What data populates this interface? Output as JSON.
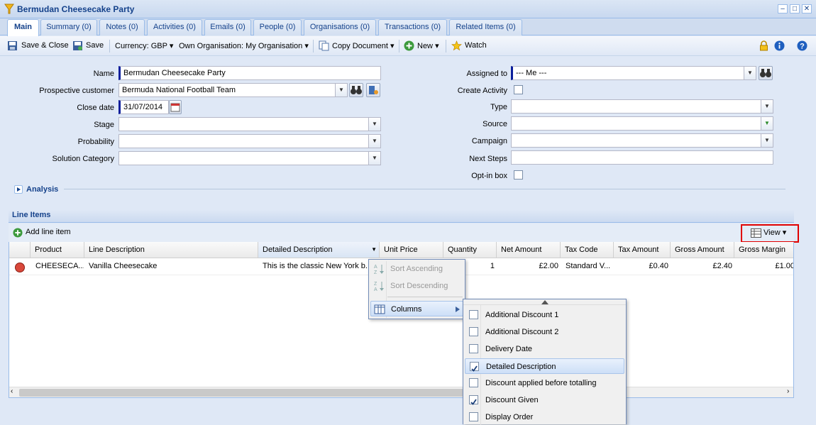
{
  "window": {
    "title": "Bermudan Cheesecake Party",
    "minimize": "–",
    "restore": "□",
    "close": "✕"
  },
  "tabs": [
    {
      "label": "Main"
    },
    {
      "label": "Summary (0)"
    },
    {
      "label": "Notes (0)"
    },
    {
      "label": "Activities (0)"
    },
    {
      "label": "Emails (0)"
    },
    {
      "label": "People (0)"
    },
    {
      "label": "Organisations (0)"
    },
    {
      "label": "Transactions (0)"
    },
    {
      "label": "Related Items (0)"
    }
  ],
  "toolbar": {
    "save_close": "Save & Close",
    "save": "Save",
    "currency": "Currency: GBP",
    "own_org": "Own Organisation: My Organisation",
    "copy_document": "Copy Document",
    "new": "New",
    "watch": "Watch",
    "dropdown_arrow": "▾"
  },
  "form": {
    "name_label": "Name",
    "name_value": "Bermudan Cheesecake Party",
    "customer_label": "Prospective customer",
    "customer_value": "Bermuda National Football Team",
    "close_date_label": "Close date",
    "close_date_value": "31/07/2014",
    "stage_label": "Stage",
    "probability_label": "Probability",
    "solution_label": "Solution Category",
    "assigned_label": "Assigned to",
    "assigned_value": "--- Me ---",
    "create_activity_label": "Create Activity",
    "type_label": "Type",
    "source_label": "Source",
    "campaign_label": "Campaign",
    "next_steps_label": "Next Steps",
    "optin_label": "Opt-in box"
  },
  "sections": {
    "analysis": "Analysis",
    "line_items": "Line Items"
  },
  "line_items": {
    "add_label": "Add line item",
    "view_label": "View",
    "columns": [
      "Product",
      "Line Description",
      "Detailed Description",
      "Unit Price",
      "Quantity",
      "Net Amount",
      "Tax Code",
      "Tax Amount",
      "Gross Amount",
      "Gross Margin"
    ],
    "rows": [
      {
        "product": "CHEESECA...",
        "line_description": "Vanilla Cheesecake",
        "detailed_description": "This is the classic New York b...",
        "quantity": "1",
        "net_amount": "£2.00",
        "tax_code": "Standard V...",
        "tax_amount": "£0.40",
        "gross_amount": "£2.40",
        "gross_margin": "£1.00"
      }
    ]
  },
  "column_menu": {
    "sort_asc": "Sort Ascending",
    "sort_desc": "Sort Descending",
    "columns": "Columns"
  },
  "columns_submenu": [
    {
      "label": "Additional Discount 1",
      "checked": false
    },
    {
      "label": "Additional Discount 2",
      "checked": false
    },
    {
      "label": "Delivery Date",
      "checked": false
    },
    {
      "label": "Detailed Description",
      "checked": true
    },
    {
      "label": "Discount applied before totalling",
      "checked": false
    },
    {
      "label": "Discount Given",
      "checked": true
    },
    {
      "label": "Display Order",
      "checked": false
    }
  ],
  "colors": {
    "highlight_box": "#e00000",
    "accent": "#15428b"
  }
}
